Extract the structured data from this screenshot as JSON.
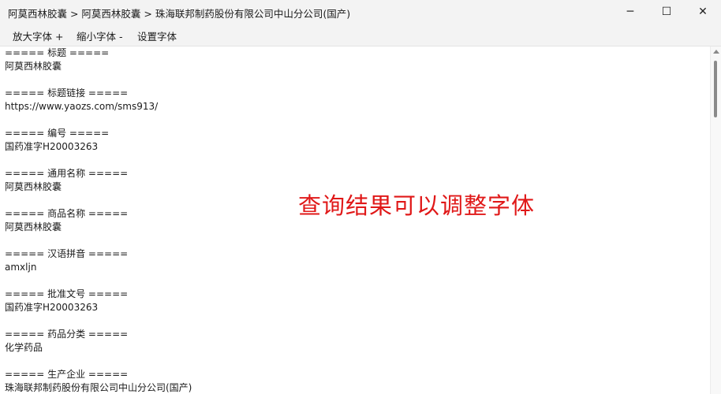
{
  "window": {
    "title": "阿莫西林胶囊 > 阿莫西林胶囊 > 珠海联邦制药股份有限公司中山分公司(国产)",
    "controls": {
      "minimize_icon": "─",
      "maximize_icon": "☐",
      "close_icon": "✕"
    }
  },
  "menu": {
    "zoom_in": "放大字体 +",
    "zoom_out": "缩小字体 -",
    "set_font": "设置字体"
  },
  "records": [
    {
      "header": "===== 标题 =====",
      "value": "阿莫西林胶囊"
    },
    {
      "header": "===== 标题链接 =====",
      "value": "https://www.yaozs.com/sms913/"
    },
    {
      "header": "===== 编号 =====",
      "value": "国药准字H20003263"
    },
    {
      "header": "===== 通用名称 =====",
      "value": "阿莫西林胶囊"
    },
    {
      "header": "===== 商品名称 =====",
      "value": "阿莫西林胶囊"
    },
    {
      "header": "===== 汉语拼音 =====",
      "value": "amxljn"
    },
    {
      "header": "===== 批准文号 =====",
      "value": "国药准字H20003263"
    },
    {
      "header": "===== 药品分类 =====",
      "value": "化学药品"
    },
    {
      "header": "===== 生产企业 =====",
      "value": "珠海联邦制药股份有限公司中山分公司(国产)"
    }
  ],
  "overlay_caption": "查询结果可以调整字体",
  "colors": {
    "caption": "#e01818",
    "chrome": "#f3f3f3"
  }
}
